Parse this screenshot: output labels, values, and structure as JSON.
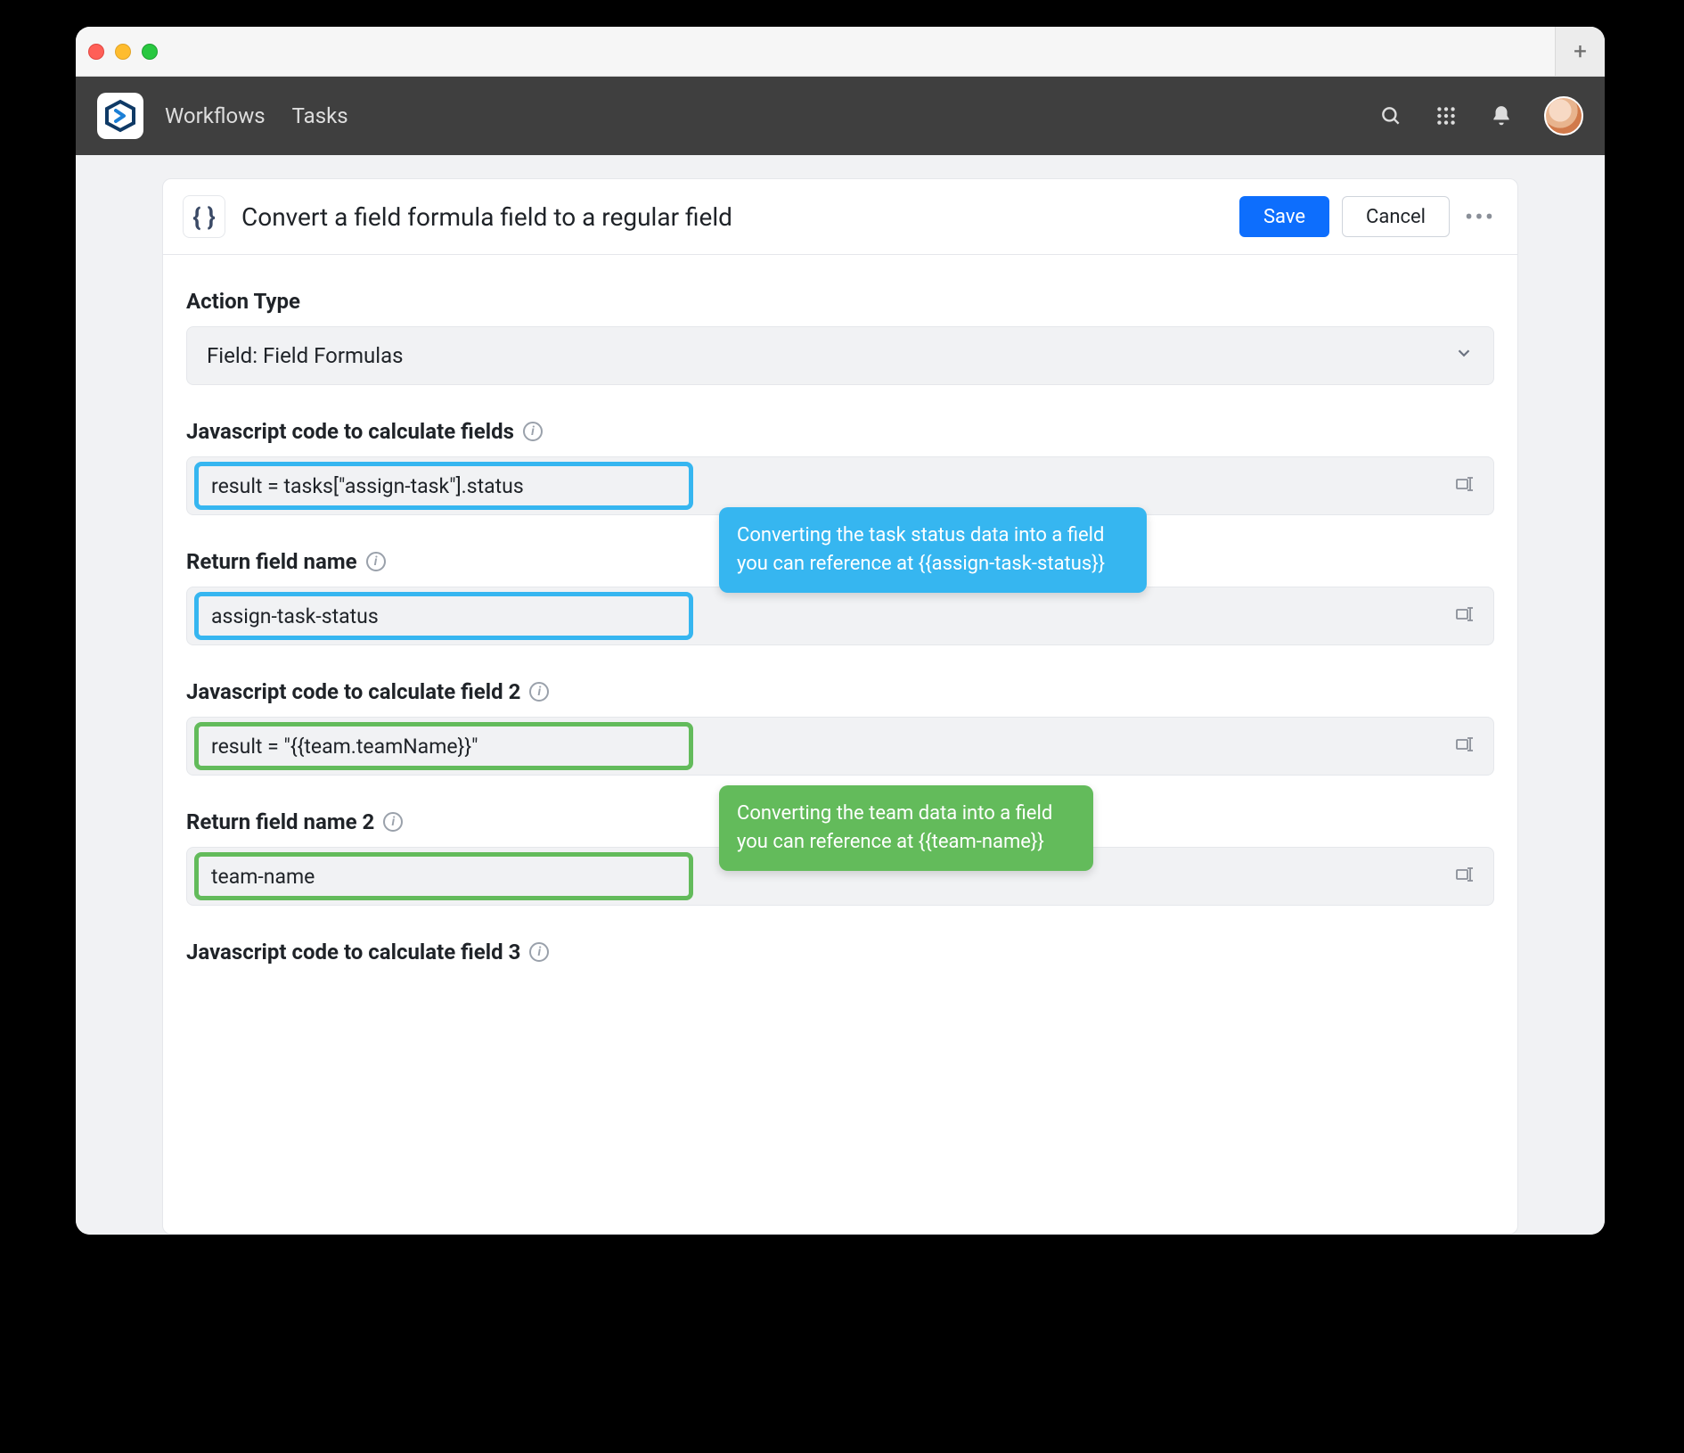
{
  "nav": {
    "workflows": "Workflows",
    "tasks": "Tasks"
  },
  "panel": {
    "title": "Convert a field formula field to a regular field",
    "icon_glyph": "{ }",
    "save": "Save",
    "cancel": "Cancel"
  },
  "sections": {
    "action_type_label": "Action Type",
    "action_type_value": "Field: Field Formulas",
    "js1_label": "Javascript code to calculate fields",
    "js1_value": "result = tasks[\"assign-task\"].status",
    "ret1_label": "Return field name",
    "ret1_value": "assign-task-status",
    "js2_label": "Javascript code to calculate field 2",
    "js2_value": "result = \"{{team.teamName}}\"",
    "ret2_label": "Return field name 2",
    "ret2_value": "team-name",
    "js3_label": "Javascript code to calculate field 3"
  },
  "callouts": {
    "blue": "Converting the task status data into a field you can reference at {{assign-task-status}}",
    "green": "Converting the team data into a field you can reference at {{team-name}}"
  }
}
